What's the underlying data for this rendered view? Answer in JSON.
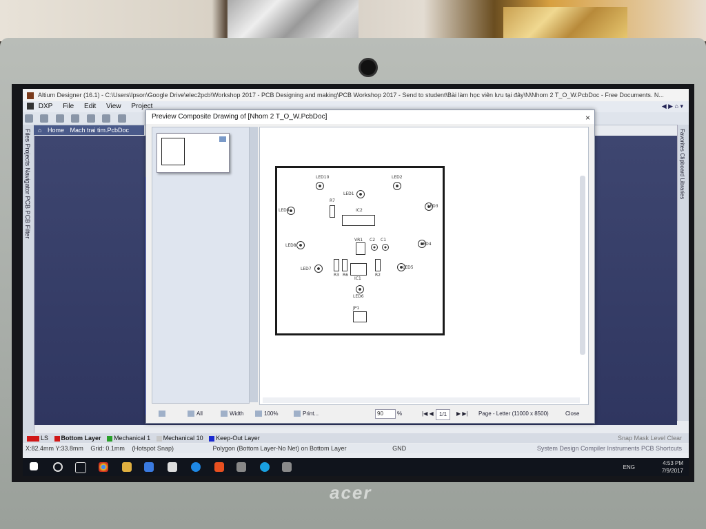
{
  "window": {
    "title": "Altium Designer (16.1) - C:\\Users\\Ipson\\Google Drive\\elec2pcb\\Workshop 2017 - PCB Designing and making\\PCB Workshop 2017 - Send to student\\Bài làm học viên lưu tại đây\\N\\Nhom 2 T_O_W.PcbDoc - Free Documents. N..."
  },
  "menu": [
    "DXP",
    "File",
    "Edit",
    "View",
    "Project"
  ],
  "doc_tabs": {
    "home": "Home",
    "doc": "Mach trai tim.PcbDoc"
  },
  "left_panels": "Files   Projects   Navigator   PCB   PCB Filter",
  "right_panels": "Favorites   Clipboard   Libraries",
  "dialog": {
    "title": "Preview Composite Drawing of [Nhom 2 T_O_W.PcbDoc]",
    "close": "×",
    "footer": {
      "all": "All",
      "width": "Width",
      "hundred": "100%",
      "print": "Print...",
      "zoom": "90",
      "zoom_unit": "%",
      "page": "1/1",
      "page_size": "Page - Letter (11000 x 8500)",
      "close": "Close"
    }
  },
  "pcb_labels": {
    "led10": "LED10",
    "led2": "LED2",
    "led1": "LED1",
    "led9": "LED9",
    "led3": "LED3",
    "r7": "R7",
    "ic2": "IC2",
    "led8": "LED8",
    "led4": "LED4",
    "vr1": "VR1",
    "c2": "C2",
    "c1": "C1",
    "led7": "LED7",
    "led5": "LED5",
    "r3": "R3",
    "r6": "R6",
    "r2": "R2",
    "ic1": "IC1",
    "led6": "LED6",
    "jp1": "JP1"
  },
  "layers": {
    "num": "LS",
    "bottom": "Bottom Layer",
    "mech1": "Mechanical 1",
    "mech10": "Mechanical 10",
    "keepout": "Keep-Out Layer",
    "right": "Snap   Mask Level   Clear"
  },
  "status": {
    "coords": "X:82.4mm Y:33.8mm",
    "grid": "Grid: 0.1mm",
    "snap": "(Hotspot Snap)",
    "polygon": "Polygon (Bottom Layer-No Net) on Bottom Layer",
    "gnd": "GND",
    "right": "System   Design Compiler   Instruments   PCB   Shortcuts"
  },
  "tray": {
    "lang": "ENG",
    "time": "4:53 PM",
    "date": "7/9/2017"
  },
  "brand": "acer",
  "colors": {
    "board_outline": "#1a1a1a",
    "bottom_layer": "#d01818",
    "mech1": "#2aa02a",
    "keepout": "#1a2ad0"
  }
}
